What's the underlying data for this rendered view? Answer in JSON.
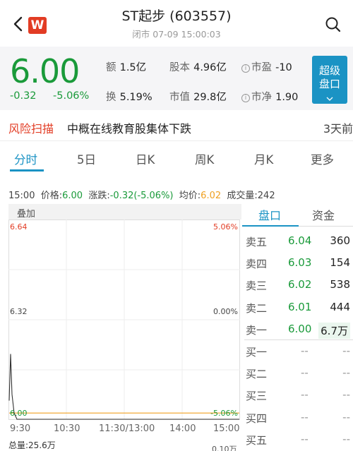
{
  "header": {
    "title": "ST起步 (603557)",
    "subtitle": "闭市 07-09 15:00:03",
    "logo_letter": "W"
  },
  "quote": {
    "price": "6.00",
    "change": "-0.32",
    "change_pct": "-5.06%",
    "amount_label": "额",
    "amount": "1.5亿",
    "shares_label": "股本",
    "shares": "4.96亿",
    "pe_label": "市盈",
    "pe": "-10",
    "turnover_label": "换",
    "turnover": "5.19%",
    "mcap_label": "市值",
    "mcap": "29.8亿",
    "pb_label": "市净",
    "pb": "1.90",
    "super_btn_line1": "超级",
    "super_btn_line2": "盘口"
  },
  "risk": {
    "label": "风险扫描",
    "text": "中概在线教育股集体下跌",
    "time": "3天前"
  },
  "tabs": [
    "分时",
    "5日",
    "日K",
    "周K",
    "月K",
    "更多"
  ],
  "info": {
    "time": "15:00",
    "price_label": "价格:",
    "price": "6.00",
    "chg_label": "涨跌:",
    "chg": "-0.32(-5.06%)",
    "avg_label": "均价:",
    "avg": "6.02",
    "vol_label": "成交量:",
    "vol": "242"
  },
  "chart": {
    "tag": "叠加",
    "y_top_left": "6.64",
    "y_top_right": "5.06%",
    "y_mid_left": "6.32",
    "y_mid_right": "0.00%",
    "y_bot_left": "6.00",
    "y_bot_right": "-5.06%",
    "x_labels": [
      "9:30",
      "10:30",
      "11:30/13:00",
      "14:00",
      "15:00"
    ],
    "total_vol": "总量:25.6万",
    "vol_right": "0.10万"
  },
  "chart_data": {
    "type": "line",
    "x": [
      "9:30",
      "9:31",
      "9:32",
      "9:33",
      "9:34",
      "15:00"
    ],
    "series": [
      {
        "values": [
          6.06,
          6.21,
          6.08,
          6.02,
          6.0,
          6.0
        ]
      }
    ],
    "ylim": [
      6.0,
      6.64
    ],
    "xlabel": "",
    "ylabel": ""
  },
  "book": {
    "tab_active": "盘口",
    "tab_other": "资金",
    "rows": [
      {
        "name": "卖五",
        "price": "6.04",
        "vol": "360"
      },
      {
        "name": "卖四",
        "price": "6.03",
        "vol": "154"
      },
      {
        "name": "卖三",
        "price": "6.02",
        "vol": "538"
      },
      {
        "name": "卖二",
        "price": "6.01",
        "vol": "444"
      },
      {
        "name": "卖一",
        "price": "6.00",
        "vol": "6.7万"
      },
      {
        "name": "买一",
        "price": "--",
        "vol": "--"
      },
      {
        "name": "买二",
        "price": "--",
        "vol": "--"
      },
      {
        "name": "买三",
        "price": "--",
        "vol": "--"
      },
      {
        "name": "买四",
        "price": "--",
        "vol": "--"
      },
      {
        "name": "买五",
        "price": "--",
        "vol": "--"
      }
    ]
  },
  "colors": {
    "down": "#1a9a3a",
    "up": "#e23c24",
    "accent": "#1b93c4",
    "avg_line": "#f0a020"
  }
}
